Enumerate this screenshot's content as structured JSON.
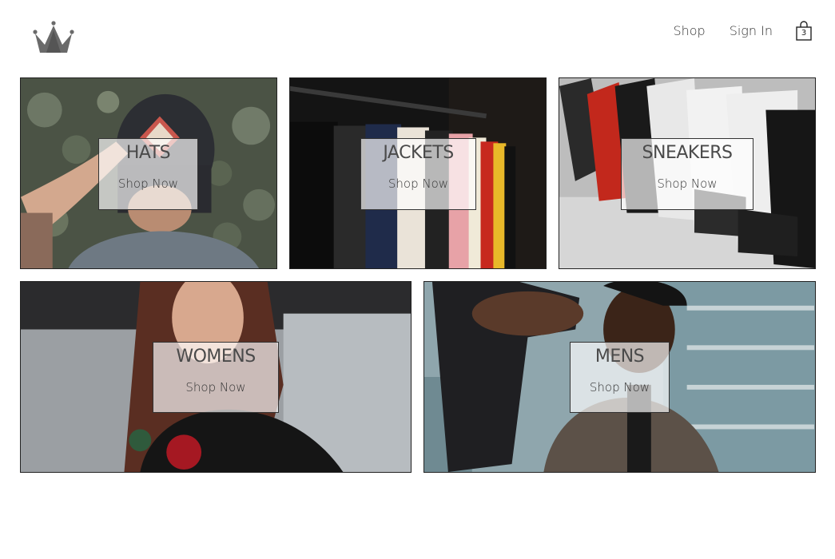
{
  "header": {
    "logo_icon": "crown-icon",
    "nav": {
      "shop": "Shop",
      "sign_in": "Sign In"
    },
    "cart": {
      "icon": "shopping-bag-icon",
      "count": "3"
    }
  },
  "categories": [
    {
      "title": "HATS",
      "cta": "Shop Now",
      "image": "man-in-cap-photo"
    },
    {
      "title": "JACKETS",
      "cta": "Shop Now",
      "image": "clothing-rack-photo"
    },
    {
      "title": "SNEAKERS",
      "cta": "Shop Now",
      "image": "sneakers-row-photo"
    },
    {
      "title": "WOMENS",
      "cta": "Shop Now",
      "image": "woman-portrait-photo"
    },
    {
      "title": "MENS",
      "cta": "Shop Now",
      "image": "man-portrait-photo"
    }
  ],
  "colors": {
    "text": "#333333",
    "border": "#222222",
    "label_bg": "rgba(255,255,255,0.68)",
    "logo": "#6a6a6a"
  }
}
